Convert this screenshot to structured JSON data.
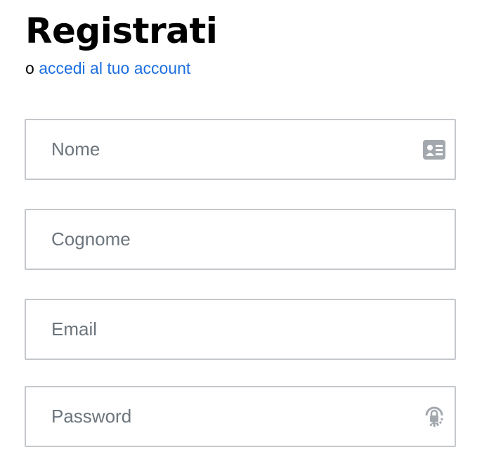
{
  "header": {
    "title": "Registrati",
    "subtitle_prefix": "o",
    "login_link": "accedi al tuo account"
  },
  "form": {
    "first_name": {
      "placeholder": "Nome",
      "value": "",
      "icon": "contact-card-icon"
    },
    "last_name": {
      "placeholder": "Cognome",
      "value": ""
    },
    "email": {
      "placeholder": "Email",
      "value": ""
    },
    "password": {
      "placeholder": "Password",
      "value": "",
      "icon": "password-manager-icon"
    }
  },
  "colors": {
    "link": "#1c6fe0",
    "field_border": "#c4c7cb",
    "placeholder": "#6c757d",
    "icon": "#a3a8ae"
  }
}
